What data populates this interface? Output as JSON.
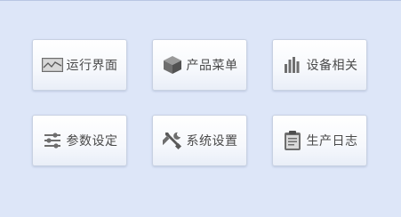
{
  "menu": {
    "tiles": [
      {
        "label": "运行界面",
        "icon": "line-chart-icon"
      },
      {
        "label": "产品菜单",
        "icon": "box-icon"
      },
      {
        "label": "设备相关",
        "icon": "bar-chart-icon"
      },
      {
        "label": "参数设定",
        "icon": "sliders-icon"
      },
      {
        "label": "系统设置",
        "icon": "tools-icon"
      },
      {
        "label": "生产日志",
        "icon": "clipboard-icon"
      }
    ]
  },
  "colors": {
    "background": "#dde6f8",
    "tile_border": "#c8d1e2",
    "label_text": "#4a4a4a",
    "icon_gray": "#6e6e6e"
  }
}
